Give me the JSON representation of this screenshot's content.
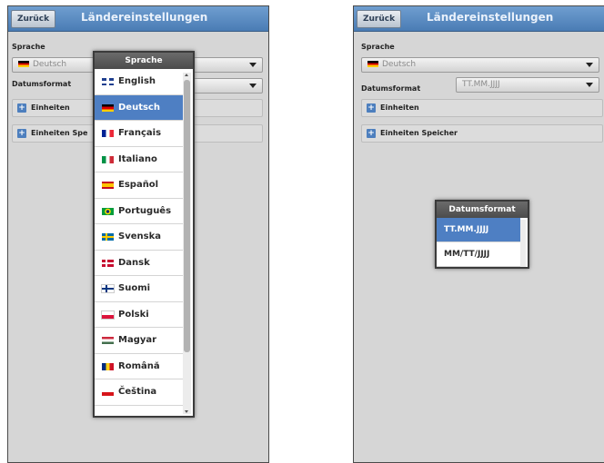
{
  "left": {
    "back_label": "Zurück",
    "title": "Ländereinstellungen",
    "language_label": "Sprache",
    "language_value": "Deutsch",
    "date_label": "Datumsformat",
    "units_label": "Einheiten",
    "storage_units_label": "Einheiten Spe"
  },
  "language_popup": {
    "title": "Sprache",
    "items": [
      {
        "label": "English",
        "flag": "flag-uk-icon"
      },
      {
        "label": "Deutsch",
        "flag": "flag-de-icon",
        "selected": true
      },
      {
        "label": "Français",
        "flag": "flag-fr-icon"
      },
      {
        "label": "Italiano",
        "flag": "flag-it-icon"
      },
      {
        "label": "Español",
        "flag": "flag-es-icon"
      },
      {
        "label": "Português",
        "flag": "flag-br-icon"
      },
      {
        "label": "Svenska",
        "flag": "flag-se-icon"
      },
      {
        "label": "Dansk",
        "flag": "flag-dk-icon"
      },
      {
        "label": "Suomi",
        "flag": "flag-fi-icon"
      },
      {
        "label": "Polski",
        "flag": "flag-pl-icon"
      },
      {
        "label": "Magyar",
        "flag": "flag-hu-icon"
      },
      {
        "label": "Română",
        "flag": "flag-ro-icon"
      },
      {
        "label": "Čeština",
        "flag": "flag-cz-icon"
      }
    ]
  },
  "right": {
    "back_label": "Zurück",
    "title": "Ländereinstellungen",
    "language_label": "Sprache",
    "language_value": "Deutsch",
    "date_label": "Datumsformat",
    "date_value": "TT.MM.JJJJ",
    "units_label": "Einheiten",
    "storage_units_label": "Einheiten Speicher"
  },
  "date_popup": {
    "title": "Datumsformat",
    "options": [
      "TT.MM.JJJJ",
      "MM/TT/JJJJ"
    ]
  },
  "colors": {
    "header": "#4a7cb4",
    "selected": "#4e7fc3",
    "panel_bg": "#d6d6d6"
  }
}
